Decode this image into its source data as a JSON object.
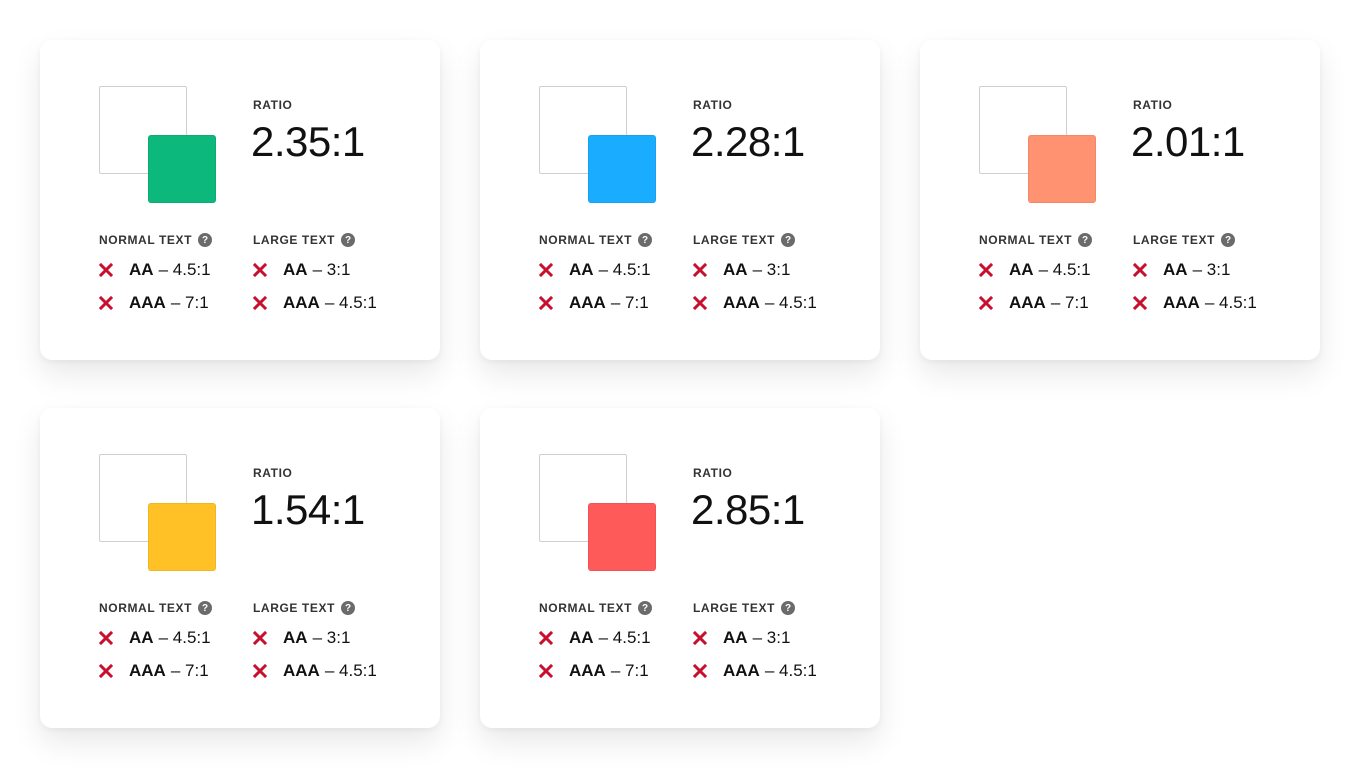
{
  "labels": {
    "ratio": "RATIO",
    "normal_text": "NORMAL TEXT",
    "large_text": "LARGE TEXT",
    "help": "?",
    "separator": "–"
  },
  "colors": {
    "fail": "#c8102e",
    "background_swatch": "#ffffff"
  },
  "cards": [
    {
      "color": "#0db87c",
      "ratio": "2.35:1",
      "normal": [
        {
          "level": "AA",
          "requirement": "4.5:1",
          "status": "fail"
        },
        {
          "level": "AAA",
          "requirement": "7:1",
          "status": "fail"
        }
      ],
      "large": [
        {
          "level": "AA",
          "requirement": "3:1",
          "status": "fail"
        },
        {
          "level": "AAA",
          "requirement": "4.5:1",
          "status": "fail"
        }
      ]
    },
    {
      "color": "#1aacff",
      "ratio": "2.28:1",
      "normal": [
        {
          "level": "AA",
          "requirement": "4.5:1",
          "status": "fail"
        },
        {
          "level": "AAA",
          "requirement": "7:1",
          "status": "fail"
        }
      ],
      "large": [
        {
          "level": "AA",
          "requirement": "3:1",
          "status": "fail"
        },
        {
          "level": "AAA",
          "requirement": "4.5:1",
          "status": "fail"
        }
      ]
    },
    {
      "color": "#ff9270",
      "ratio": "2.01:1",
      "normal": [
        {
          "level": "AA",
          "requirement": "4.5:1",
          "status": "fail"
        },
        {
          "level": "AAA",
          "requirement": "7:1",
          "status": "fail"
        }
      ],
      "large": [
        {
          "level": "AA",
          "requirement": "3:1",
          "status": "fail"
        },
        {
          "level": "AAA",
          "requirement": "4.5:1",
          "status": "fail"
        }
      ]
    },
    {
      "color": "#ffc125",
      "ratio": "1.54:1",
      "normal": [
        {
          "level": "AA",
          "requirement": "4.5:1",
          "status": "fail"
        },
        {
          "level": "AAA",
          "requirement": "7:1",
          "status": "fail"
        }
      ],
      "large": [
        {
          "level": "AA",
          "requirement": "3:1",
          "status": "fail"
        },
        {
          "level": "AAA",
          "requirement": "4.5:1",
          "status": "fail"
        }
      ]
    },
    {
      "color": "#ff5a5a",
      "ratio": "2.85:1",
      "normal": [
        {
          "level": "AA",
          "requirement": "4.5:1",
          "status": "fail"
        },
        {
          "level": "AAA",
          "requirement": "7:1",
          "status": "fail"
        }
      ],
      "large": [
        {
          "level": "AA",
          "requirement": "3:1",
          "status": "fail"
        },
        {
          "level": "AAA",
          "requirement": "4.5:1",
          "status": "fail"
        }
      ]
    }
  ]
}
